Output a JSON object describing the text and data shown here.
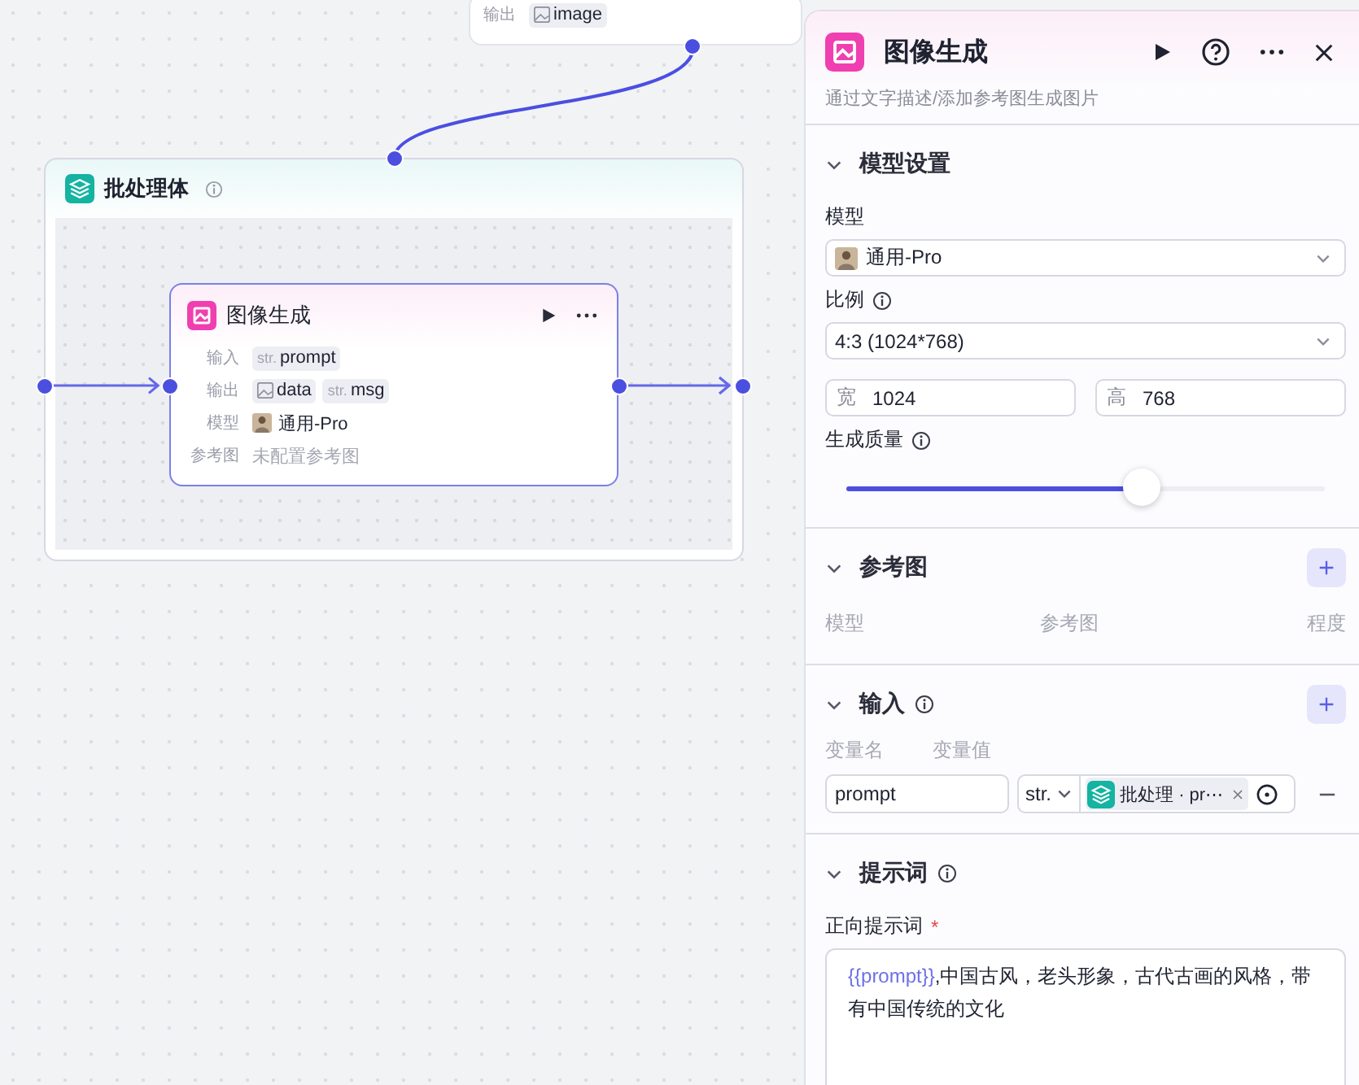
{
  "canvas": {
    "top_node": {
      "output_label": "输出",
      "outputs": [
        {
          "kind": "image",
          "name": "image"
        }
      ]
    },
    "batch_node": {
      "title": "批处理体",
      "inner_node": {
        "title": "图像生成",
        "rows": [
          {
            "label": "输入",
            "kind": "chips",
            "chips": [
              {
                "kind": "str",
                "type_label": "str.",
                "name": "prompt"
              }
            ]
          },
          {
            "label": "输出",
            "kind": "chips",
            "chips": [
              {
                "kind": "image",
                "name": "data"
              },
              {
                "kind": "str",
                "type_label": "str.",
                "name": "msg"
              }
            ]
          },
          {
            "label": "模型",
            "kind": "model",
            "value": "通用-Pro"
          },
          {
            "label": "参考图",
            "kind": "empty",
            "value": "未配置参考图"
          }
        ]
      }
    }
  },
  "panel": {
    "title": "图像生成",
    "description": "通过文字描述/添加参考图生成图片",
    "model_settings": {
      "title": "模型设置",
      "expanded": true,
      "model_label": "模型",
      "model_value": "通用-Pro",
      "ratio_label": "比例",
      "ratio_value": "4:3 (1024*768)",
      "width_label": "宽",
      "width_value": "1024",
      "height_label": "高",
      "height_value": "768",
      "quality": {
        "label": "生成质量",
        "level": 0.62
      }
    },
    "reference": {
      "title": "参考图",
      "expanded": true,
      "columns": [
        "模型",
        "参考图",
        "程度"
      ]
    },
    "inputs": {
      "title": "输入",
      "expanded": true,
      "columns": [
        "变量名",
        "变量值"
      ],
      "rows": [
        {
          "name": "prompt",
          "type": "str.",
          "ref_text": "批处理 · pr⋯"
        }
      ]
    },
    "prompt": {
      "title": "提示词",
      "expanded": true,
      "field_label": "正向提示词",
      "required_mark": "*",
      "parts": [
        {
          "kind": "variable",
          "text": "{{prompt}}"
        },
        {
          "kind": "text",
          "text": ",中国古风，老头形象，古代古画的风格，带有中国传统的文化"
        }
      ]
    }
  }
}
